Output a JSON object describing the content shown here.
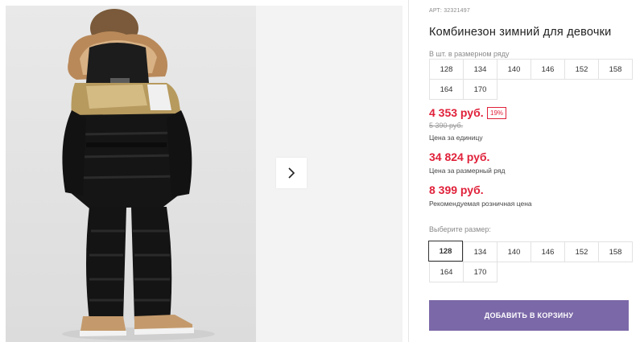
{
  "product": {
    "sku_label": "АРТ:",
    "sku": "32321497",
    "title": "Комбинезон зимний для девочки"
  },
  "size_row": {
    "label": "В шт. в размерном ряду",
    "sizes": [
      "128",
      "134",
      "140",
      "146",
      "152",
      "158",
      "164",
      "170"
    ]
  },
  "pricing": {
    "unit_price": "4 353 руб.",
    "discount_badge": "19%",
    "old_price": "5 390 руб.",
    "unit_caption": "Цена за единицу",
    "row_price": "34 824 руб.",
    "row_caption": "Цена за размерный ряд",
    "retail_price": "8 399 руб.",
    "retail_caption": "Рекомендуемая розничная цена"
  },
  "size_select": {
    "label": "Выберите размер:",
    "sizes": [
      "128",
      "134",
      "140",
      "146",
      "152",
      "158",
      "164",
      "170"
    ],
    "selected": "128"
  },
  "cart": {
    "button_label": "ДОБАВИТЬ В КОРЗИНУ"
  },
  "colors": {
    "price_red": "#e0213a",
    "cart_button": "#7b68a8"
  },
  "icons": {
    "gallery_next": "chevron-right-icon"
  }
}
